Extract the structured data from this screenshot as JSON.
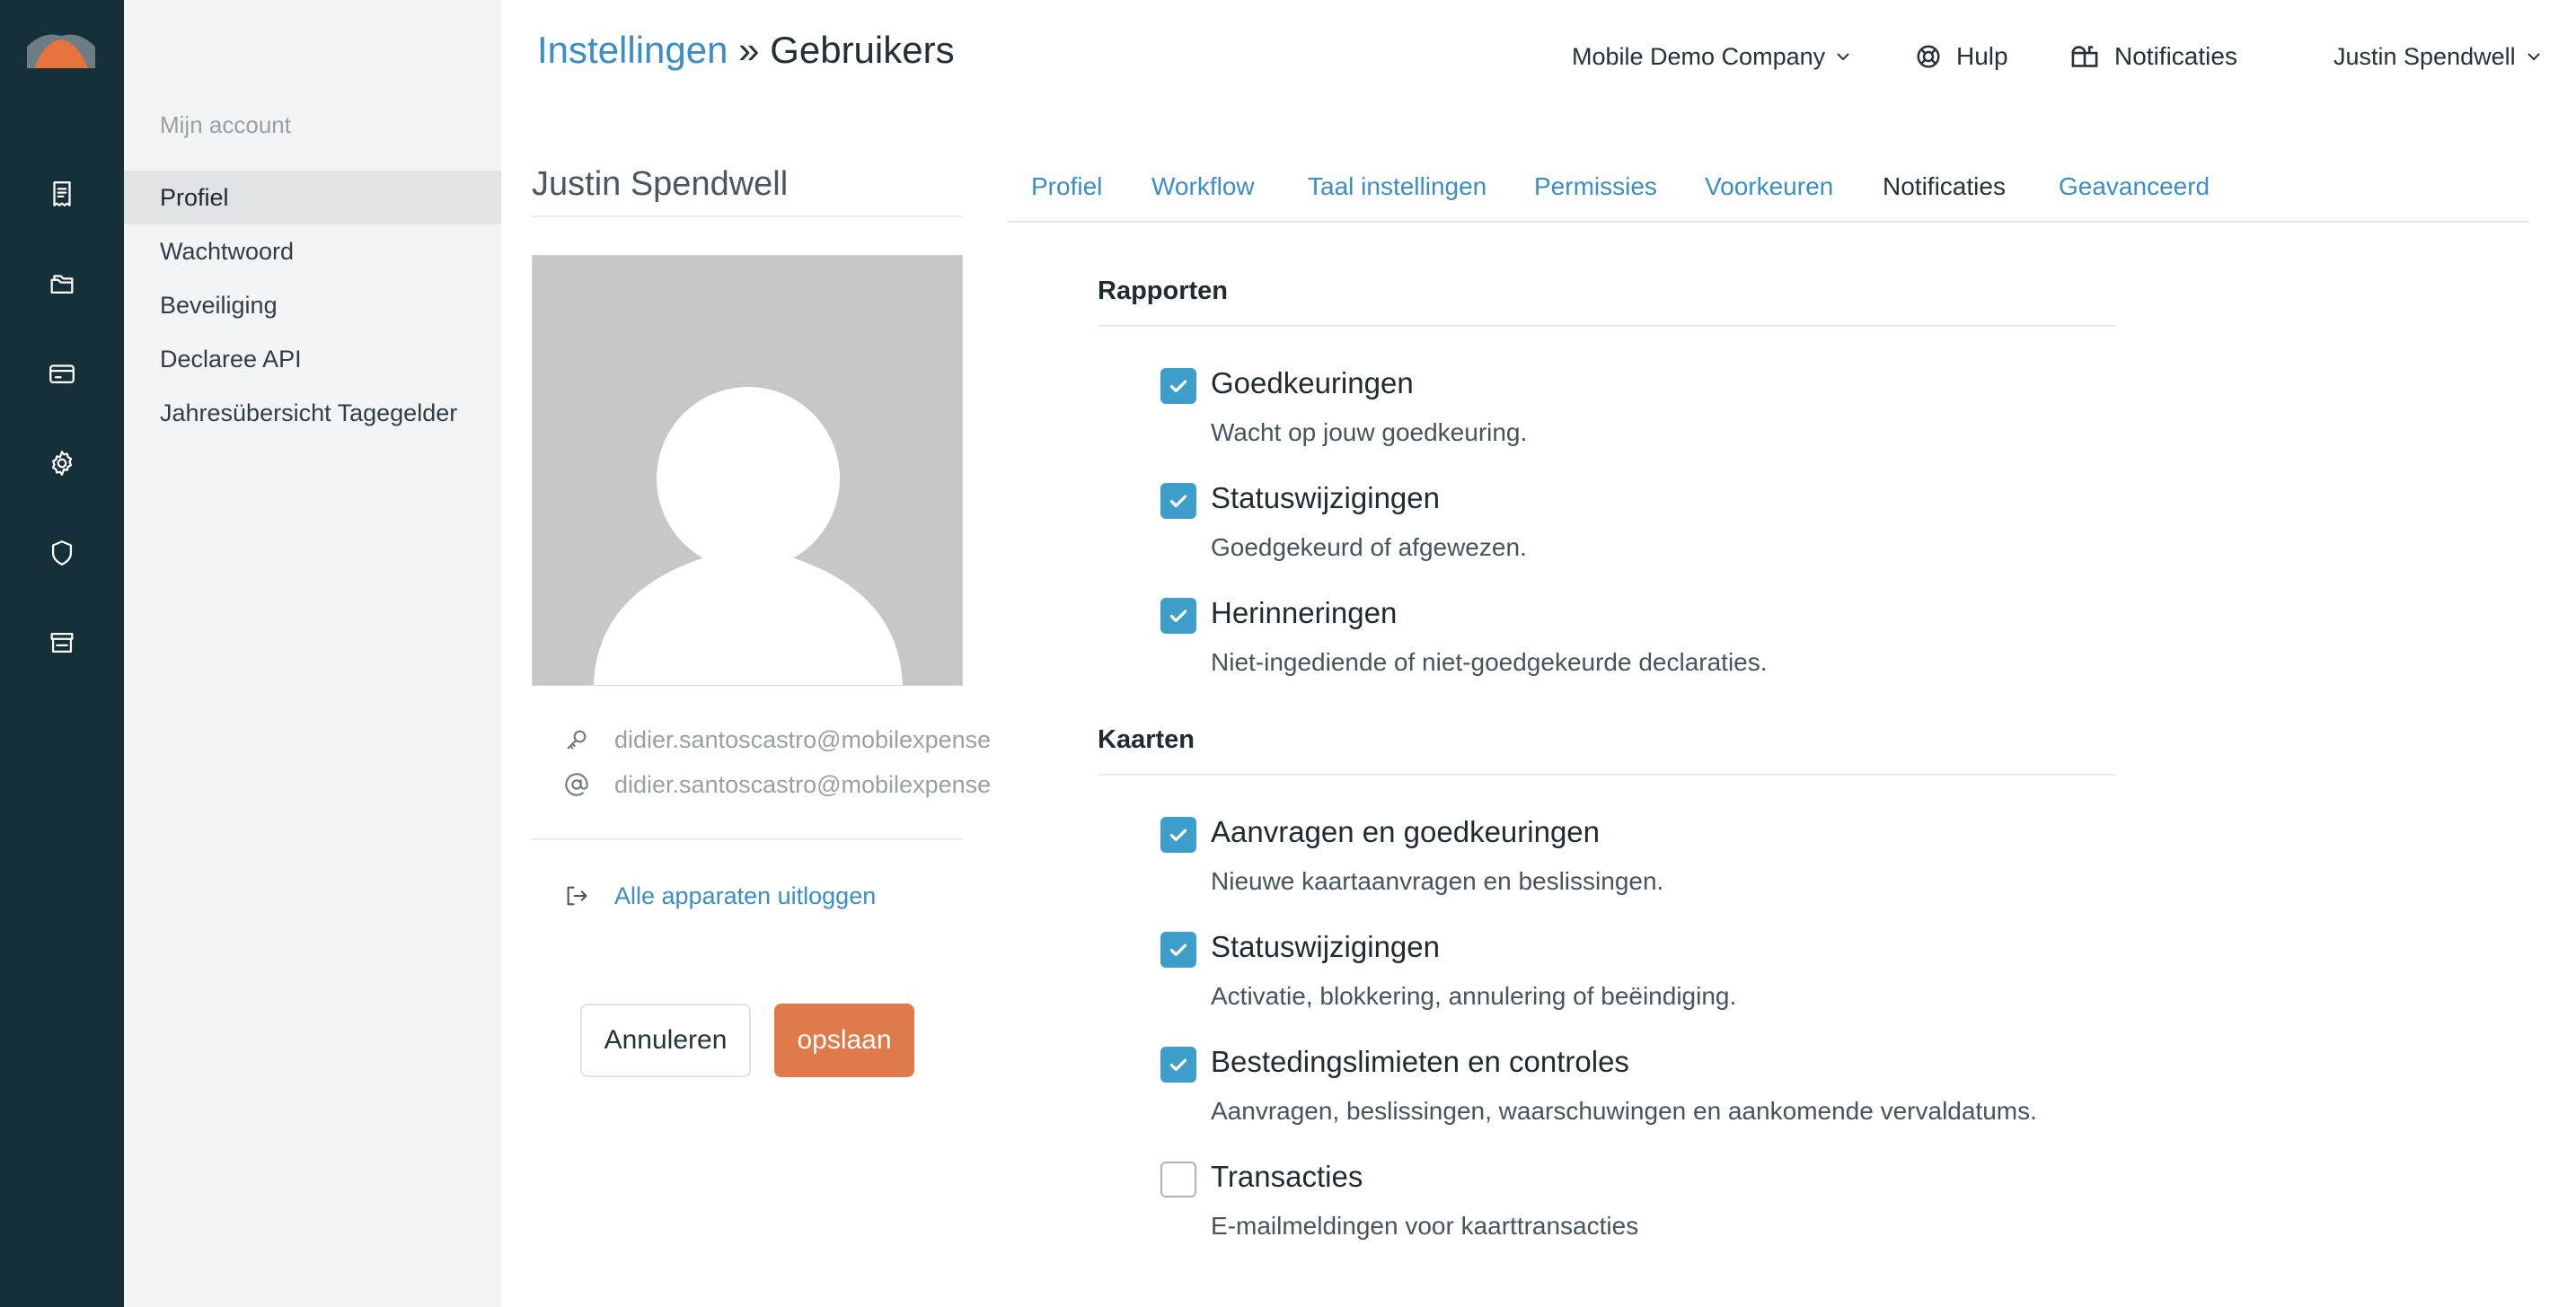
{
  "sidebar": {
    "heading": "Mijn account",
    "items": [
      {
        "label": "Profiel",
        "active": true
      },
      {
        "label": "Wachtwoord",
        "active": false
      },
      {
        "label": "Beveiliging",
        "active": false
      },
      {
        "label": "Declaree API",
        "active": false
      },
      {
        "label": "Jahresübersicht Tagegelder",
        "active": false
      }
    ]
  },
  "rail": {
    "icons": [
      "receipt-icon",
      "folders-icon",
      "credit-card-icon",
      "gear-icon",
      "shield-icon",
      "store-icon"
    ]
  },
  "header": {
    "breadcrumb_link": "Instellingen",
    "breadcrumb_separator": "»",
    "breadcrumb_current": "Gebruikers",
    "company": "Mobile Demo Company",
    "help": "Hulp",
    "notifications": "Notificaties",
    "user": "Justin Spendwell"
  },
  "profile": {
    "name": "Justin Spendwell",
    "login": "didier.santoscastro@mobilexpense",
    "email": "didier.santoscastro@mobilexpense",
    "logout_all": "Alle apparaten uitloggen",
    "cancel": "Annuleren",
    "save": "opslaan"
  },
  "tabs": [
    {
      "label": "Profiel",
      "active": false
    },
    {
      "label": "Workflow",
      "active": false
    },
    {
      "label": "Taal instellingen",
      "active": false
    },
    {
      "label": "Permissies",
      "active": false
    },
    {
      "label": "Voorkeuren",
      "active": false
    },
    {
      "label": "Notificaties",
      "active": true
    },
    {
      "label": "Geavanceerd",
      "active": false
    }
  ],
  "sections": [
    {
      "title": "Rapporten",
      "options": [
        {
          "label": "Goedkeuringen",
          "desc": "Wacht op jouw goedkeuring.",
          "checked": true
        },
        {
          "label": "Statuswijzigingen",
          "desc": "Goedgekeurd of afgewezen.",
          "checked": true
        },
        {
          "label": "Herinneringen",
          "desc": "Niet-ingediende of niet-goedgekeurde declaraties.",
          "checked": true
        }
      ]
    },
    {
      "title": "Kaarten",
      "options": [
        {
          "label": "Aanvragen en goedkeuringen",
          "desc": "Nieuwe kaartaanvragen en beslissingen.",
          "checked": true
        },
        {
          "label": "Statuswijzigingen",
          "desc": "Activatie, blokkering, annulering of beëindiging.",
          "checked": true
        },
        {
          "label": "Bestedingslimieten en controles",
          "desc": "Aanvragen, beslissingen, waarschuwingen en aankomende vervaldatums.",
          "checked": true
        },
        {
          "label": "Transacties",
          "desc": "E-mailmeldingen voor kaarttransacties",
          "checked": false
        }
      ]
    }
  ],
  "colors": {
    "rail": "#163039",
    "accent_blue": "#3a8dc6",
    "checkbox": "#3d9fc9",
    "save_button": "#de7a4c",
    "logo_orange": "#e8733f"
  }
}
